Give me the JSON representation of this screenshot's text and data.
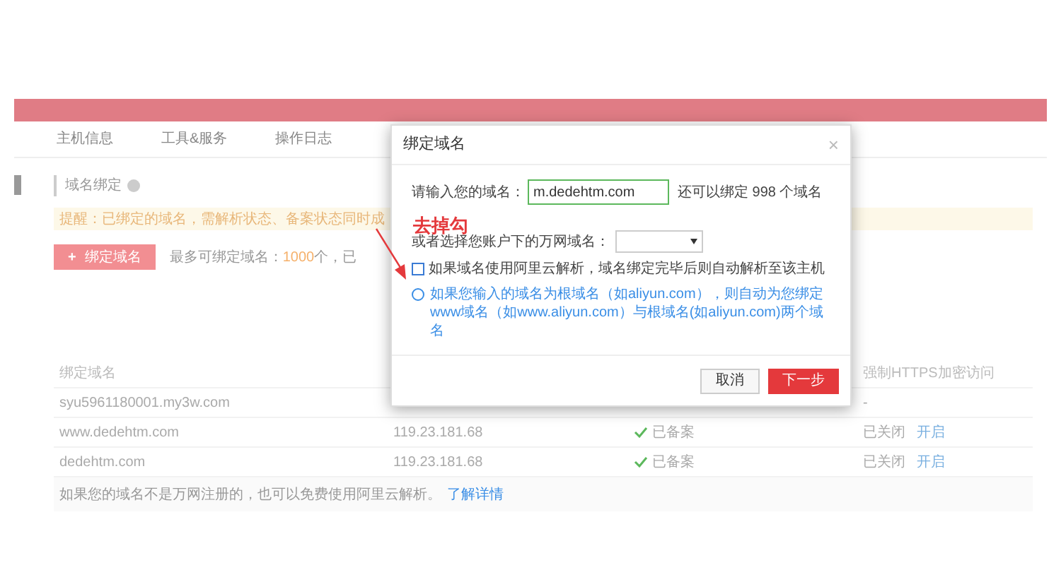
{
  "nav": {
    "tabs": [
      {
        "label": "主机信息",
        "selected": false
      },
      {
        "label": "工具&服务",
        "selected": false
      },
      {
        "label": "操作日志",
        "selected": false
      }
    ]
  },
  "section": {
    "title": "域名绑定"
  },
  "notice": "提醒：已绑定的域名，需解析状态、备案状态同时成",
  "bind_button": {
    "icon": "+",
    "label": "绑定域名"
  },
  "limit": {
    "prefix": "最多可绑定域名：",
    "count": "1000",
    "suffix": "个，已"
  },
  "table": {
    "columns": [
      "绑定域名",
      "强制HTTPS加密访问"
    ],
    "rows": [
      {
        "domain": "syu5961180001.my3w.com",
        "https": "-"
      },
      {
        "domain": "www.dedehtm.com",
        "ip": "119.23.181.68",
        "record": "已备案",
        "https": "已关闭",
        "action": "开启"
      },
      {
        "domain": "dedehtm.com",
        "ip": "119.23.181.68",
        "record": "已备案",
        "https": "已关闭",
        "action": "开启"
      }
    ]
  },
  "footer": {
    "text": "如果您的域名不是万网注册的，也可以免费使用阿里云解析。",
    "link": "了解详情"
  },
  "dialog": {
    "title": "绑定域名",
    "close": "×",
    "domain_label": "请输入您的域名：",
    "domain_value": "m.dedehtm.com",
    "remaining": "还可以绑定 998 个域名",
    "select_label": "或者选择您账户下的万网域名：",
    "auto_resolve": {
      "label": "如果域名使用阿里云解析，域名绑定完毕后则自动解析至该主机",
      "checked": false
    },
    "info": "如果您输入的域名为根域名（如aliyun.com），则自动为您绑定www域名（如www.aliyun.com）与根域名(如aliyun.com)两个域名",
    "buttons": [
      {
        "label": "取消",
        "kind": "secondary"
      },
      {
        "label": "下一步",
        "kind": "primary"
      }
    ]
  },
  "annotation": "去掉勾"
}
